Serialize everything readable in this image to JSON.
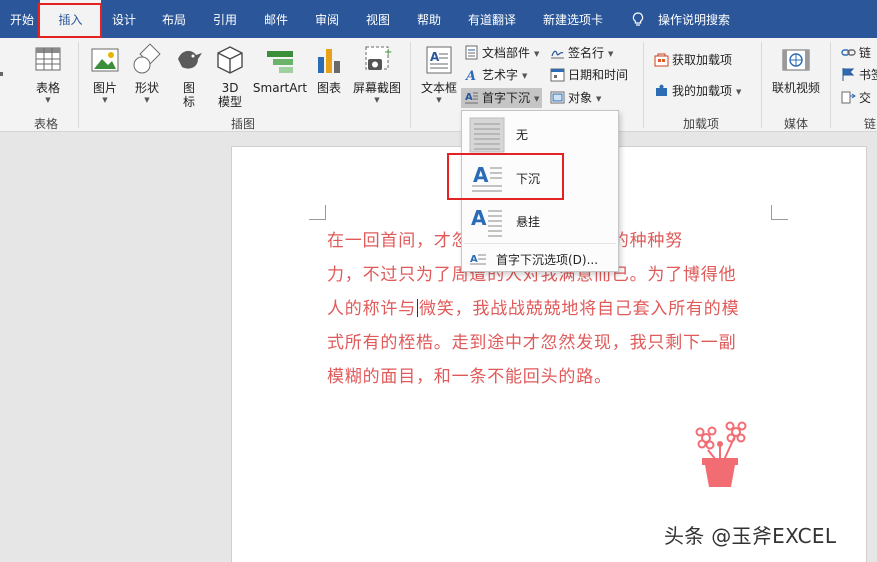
{
  "tabs": [
    "开始",
    "插入",
    "设计",
    "布局",
    "引用",
    "邮件",
    "审阅",
    "视图",
    "帮助",
    "有道翻译",
    "新建选项卡"
  ],
  "active_tab": "插入",
  "tell_me": "操作说明搜索",
  "ribbon": {
    "table_btn": "表格",
    "table_group": "表格",
    "picture_btn": "图片",
    "shapes_btn": "形状",
    "icons_btn": "图\n标",
    "model3d_btn": "3D\n模型",
    "smartart_btn": "SmartArt",
    "chart_btn": "图表",
    "screenshot_btn": "屏幕截图",
    "illustrations_group": "插图",
    "textbox_btn": "文本框",
    "quickparts_btn": "文档部件",
    "wordart_btn": "艺术字",
    "dropcap_btn": "首字下沉",
    "signature_btn": "签名行",
    "datetime_btn": "日期和时间",
    "object_btn": "对象",
    "getaddins_btn": "获取加载项",
    "myaddins_btn": "我的加载项",
    "addins_group": "加载项",
    "onlinevideo_btn": "联机视频",
    "media_group": "媒体",
    "link_btn": "链",
    "bookmark_btn": "书签",
    "crossref_btn": "交",
    "links_group": "链"
  },
  "dropcap_menu": {
    "none": "无",
    "dropped": "下沉",
    "margin": "悬挂",
    "options": "首字下沉选项(D)..."
  },
  "document": {
    "lines": [
      "在一回首间，才忽然发现原来我一生的种种努",
      "力，不过只为了周遭的人对我满意而已。为了博得他",
      "人的称许与",
      "微笑，我战战兢兢地将自己套入所有的模",
      "式所有的桎梏。走到途中才忽然发现，我只剩下一副",
      "模糊的面目，和一条不能回头的路。"
    ]
  },
  "watermark": "头条 @玉斧EXCEL",
  "colors": {
    "tab_bar": "#2b579a",
    "highlight_box": "#e52222",
    "body_text": "#e05a5a"
  }
}
